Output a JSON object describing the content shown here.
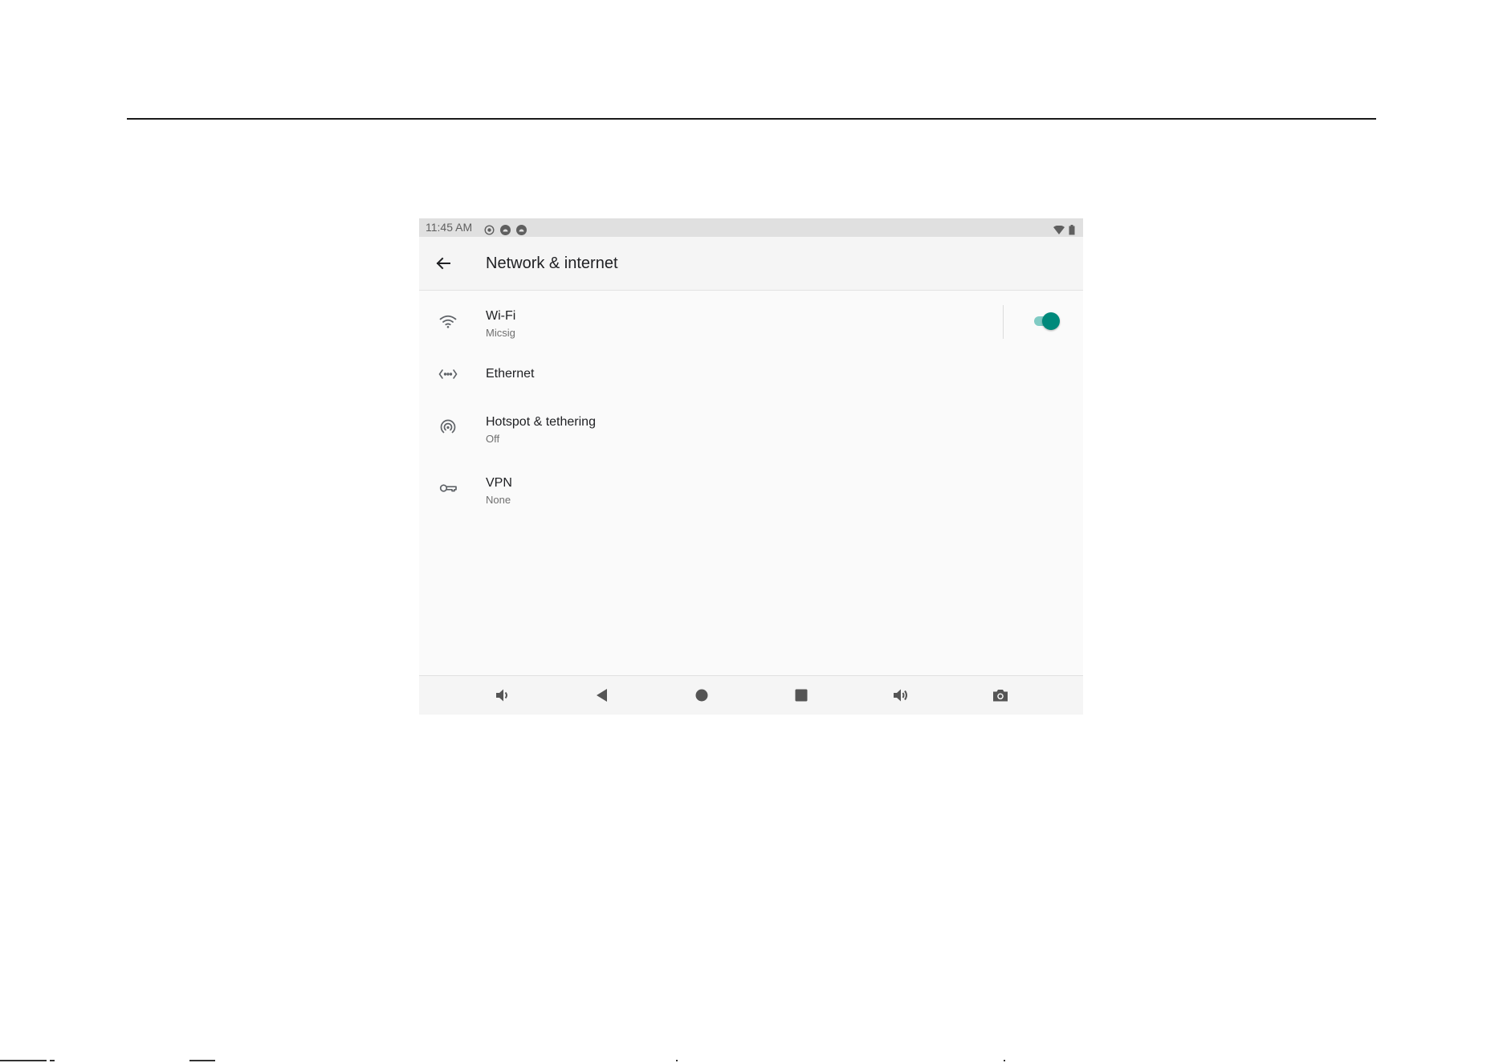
{
  "status_bar": {
    "time": "11:45 AM",
    "notification_icons": [
      "settings-dot-icon",
      "android-circle-icon",
      "android-circle-icon"
    ],
    "system_icons": [
      "wifi-signal-icon",
      "battery-icon"
    ]
  },
  "app_bar": {
    "back_icon": "arrow-left-icon",
    "title": "Network & internet"
  },
  "settings_list": [
    {
      "icon": "wifi-icon",
      "title": "Wi-Fi",
      "summary": "Micsig",
      "toggle_on": true
    },
    {
      "icon": "ethernet-icon",
      "title": "Ethernet"
    },
    {
      "icon": "hotspot-icon",
      "title": "Hotspot & tethering",
      "summary": "Off"
    },
    {
      "icon": "vpn-key-icon",
      "title": "VPN",
      "summary": "None"
    }
  ],
  "nav_bar": {
    "buttons": [
      "volume-down-icon",
      "back-triangle-icon",
      "home-circle-icon",
      "recents-square-icon",
      "volume-up-icon",
      "camera-icon"
    ]
  },
  "colors": {
    "accent": "#00897b",
    "accent_track": "#80cbc4",
    "status_bar_bg": "#e0e0e0",
    "app_bar_bg": "#f5f5f5",
    "content_bg": "#fafafa"
  }
}
